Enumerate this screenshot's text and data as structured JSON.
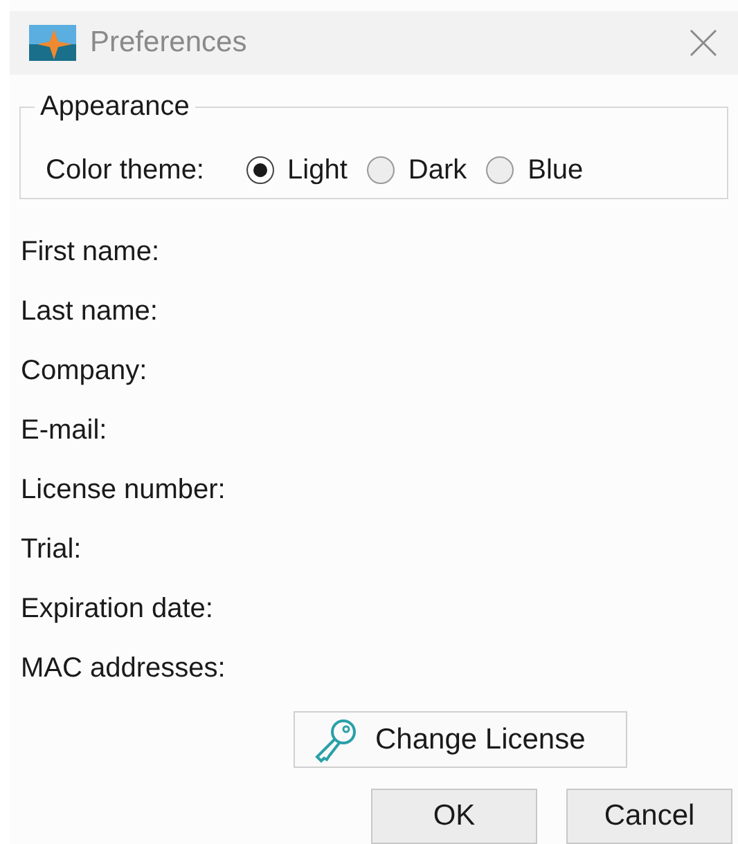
{
  "window": {
    "title": "Preferences"
  },
  "appearance": {
    "title": "Appearance",
    "label": "Color theme:",
    "options": [
      {
        "label": "Light",
        "selected": true
      },
      {
        "label": "Dark",
        "selected": false
      },
      {
        "label": "Blue",
        "selected": false
      }
    ]
  },
  "fields": [
    {
      "label": "First name:"
    },
    {
      "label": "Last name:"
    },
    {
      "label": "Company:"
    },
    {
      "label": "E-mail:"
    },
    {
      "label": "License number:"
    },
    {
      "label": "Trial:"
    },
    {
      "label": "Expiration date:"
    },
    {
      "label": "MAC addresses:"
    }
  ],
  "change_license_button": "Change License",
  "buttons": [
    "OK",
    "Cancel"
  ]
}
